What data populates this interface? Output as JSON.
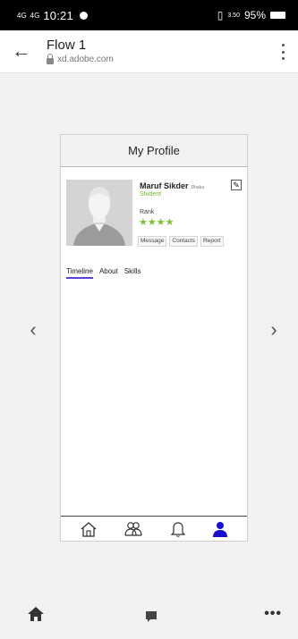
{
  "status_bar": {
    "signal1": "4G",
    "signal2": "4G",
    "time": "10:21",
    "net_speed": "3.50",
    "battery": "95%"
  },
  "app_bar": {
    "title": "Flow 1",
    "url": "xd.adobe.com"
  },
  "profile": {
    "header_title": "My Profile",
    "name": "Maruf Sikder",
    "place": "Dhaka",
    "role": "Student",
    "rank_label": "Rank",
    "stars": "★★★★",
    "actions": [
      "Message",
      "Contacts",
      "Report"
    ],
    "tabs": [
      "Timeline",
      "About",
      "Skills"
    ],
    "active_tab": "Timeline"
  },
  "bottom_nav": {
    "icons": [
      "home-icon",
      "groups-icon",
      "bell-icon",
      "person-icon"
    ],
    "active_color": "#1a0bd1"
  },
  "colors": {
    "accent": "#5b3fd8",
    "star": "#7cc12f",
    "role": "#6bbf2c"
  }
}
